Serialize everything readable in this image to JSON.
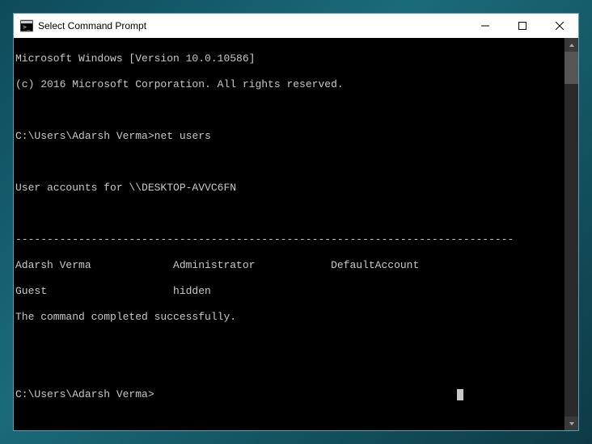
{
  "window": {
    "title": "Select Command Prompt"
  },
  "terminal": {
    "header_line1": "Microsoft Windows [Version 10.0.10586]",
    "header_line2": "(c) 2016 Microsoft Corporation. All rights reserved.",
    "prompt1": "C:\\Users\\Adarsh Verma>",
    "command1": "net users",
    "output_heading": "User accounts for \\\\DESKTOP-AVVC6FN",
    "separator": "-------------------------------------------------------------------------------",
    "users_row1": "Adarsh Verma             Administrator            DefaultAccount",
    "users_row2": "Guest                    hidden",
    "completion": "The command completed successfully.",
    "prompt2": "C:\\Users\\Adarsh Verma>"
  }
}
